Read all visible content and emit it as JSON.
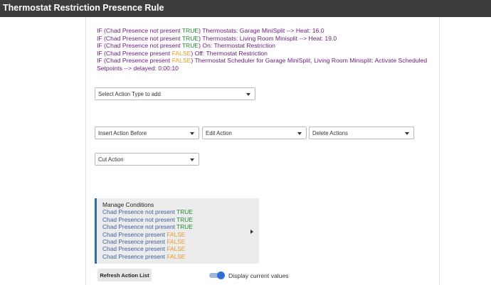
{
  "header": {
    "title": "Thermostat Restriction Presence Rule"
  },
  "actions": [
    {
      "prefix": "IF (Chad Presence not present ",
      "flag": "TRUE",
      "state": "true",
      "suffix": ") Thermostats: Garage MiniSplit --> Heat: 16.0"
    },
    {
      "prefix": "IF (Chad Presence not present ",
      "flag": "TRUE",
      "state": "true",
      "suffix": ") Thermostats: Living Room Minisplit --> Heat: 19.0"
    },
    {
      "prefix": "IF (Chad Presence not present ",
      "flag": "TRUE",
      "state": "true",
      "suffix": ") On: Thermostat Restriction"
    },
    {
      "prefix": "IF (Chad Presence present ",
      "flag": "FALSE",
      "state": "false",
      "suffix": ") Off: Thermostat Restriction"
    },
    {
      "prefix": "IF (Chad Presence present ",
      "flag": "FALSE",
      "state": "false",
      "suffix": ") Thermostat Scheduler for Garage MiniSplit, Living Room Minisplit: Activate Scheduled Setpoints --> delayed: 0:00:10"
    }
  ],
  "selects": {
    "action_type": "Select Action Type to add",
    "insert_before": "Insert Action Before",
    "edit": "Edit Action",
    "delete": "Delete Actions",
    "cut": "Cut Action"
  },
  "conditions": {
    "title": "Manage Conditions",
    "items": [
      {
        "text": "Chad Presence not present ",
        "flag": "TRUE",
        "state": "true"
      },
      {
        "text": "Chad Presence not present ",
        "flag": "TRUE",
        "state": "true"
      },
      {
        "text": "Chad Presence not present ",
        "flag": "TRUE",
        "state": "true"
      },
      {
        "text": "Chad Presence present ",
        "flag": "FALSE",
        "state": "false"
      },
      {
        "text": "Chad Presence present ",
        "flag": "FALSE",
        "state": "false"
      },
      {
        "text": "Chad Presence present ",
        "flag": "FALSE",
        "state": "false"
      },
      {
        "text": "Chad Presence present ",
        "flag": "FALSE",
        "state": "false"
      }
    ]
  },
  "buttons": {
    "refresh": "Refresh Action List"
  },
  "toggle": {
    "label": "Display current values",
    "on": true
  },
  "colors": {
    "true": "#1f8a2e",
    "false": "#e89a2b",
    "action_text": "#6a1b7a",
    "condition_text": "#3c5fa0",
    "accent": "#2f6fb0"
  }
}
